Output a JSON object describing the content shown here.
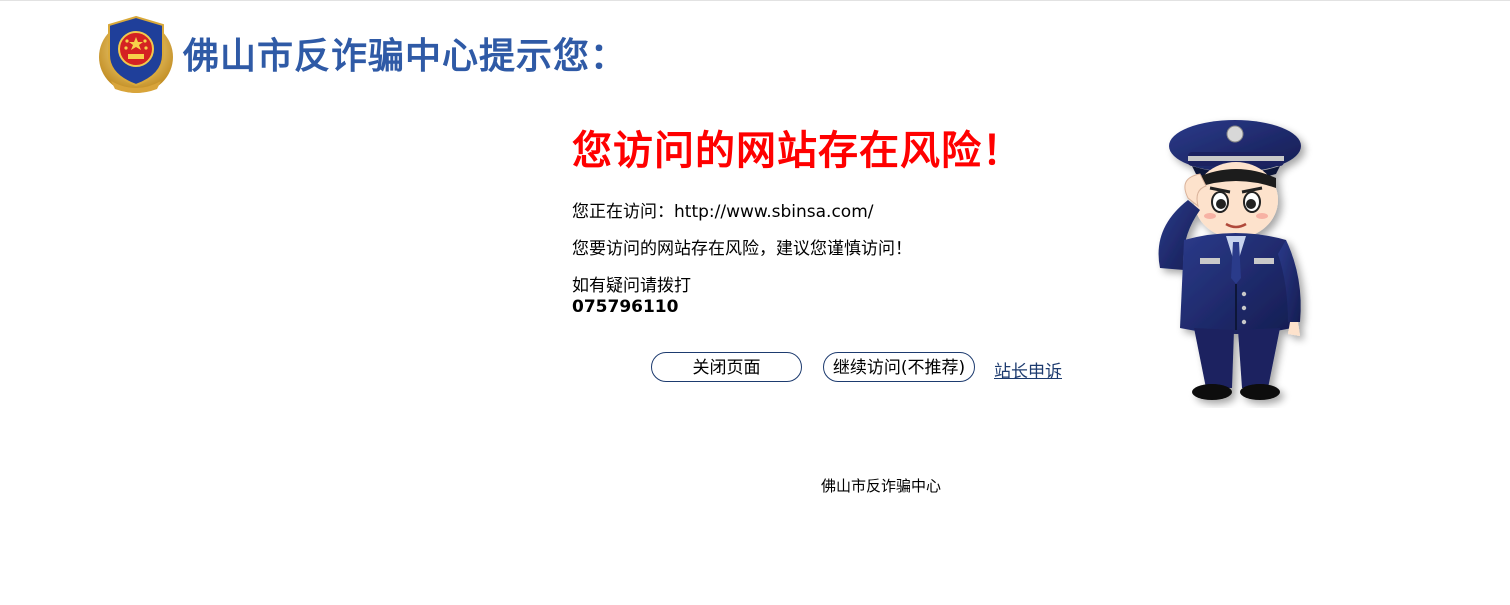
{
  "header": {
    "title": "佛山市反诈骗中心提示您：",
    "emblem_icon": "police-emblem-icon"
  },
  "warning": {
    "title": "您访问的网站存在风险！",
    "visiting_line": "您正在访问：http://www.sbinsa.com/",
    "risk_line": "您要访问的网站存在风险，建议您谨慎访问！",
    "help_line": "如有疑问请拨打",
    "phone": "075796110"
  },
  "actions": {
    "close_label": "关闭页面",
    "continue_label": "继续访问(不推荐)",
    "appeal_label": "站长申诉"
  },
  "footer": {
    "text": "佛山市反诈骗中心"
  },
  "colors": {
    "title_blue": "#2f5aa6",
    "warning_red": "#ff0000",
    "button_border": "#1d3b6f"
  },
  "illustration": {
    "icon": "police-officer-saluting-icon"
  }
}
